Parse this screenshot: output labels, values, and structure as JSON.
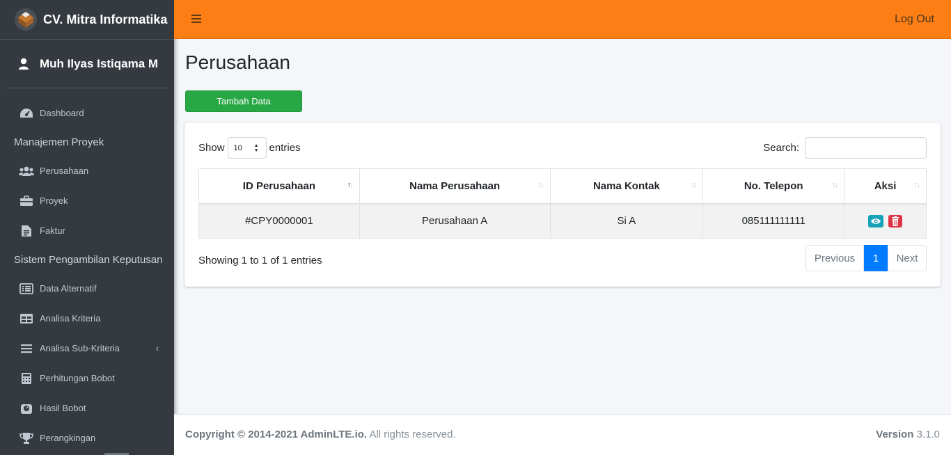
{
  "brand": {
    "name": "CV. Mitra Informatika",
    "logo_icon": "adminlte-logo-icon"
  },
  "user": {
    "name": "Muh Ilyas Istiqama M"
  },
  "sidebar": {
    "items": [
      {
        "label": "Dashboard",
        "icon": "tachometer-icon"
      },
      {
        "header": "Manajemen Proyek"
      },
      {
        "label": "Perusahaan",
        "icon": "users-icon"
      },
      {
        "label": "Proyek",
        "icon": "briefcase-icon"
      },
      {
        "label": "Faktur",
        "icon": "file-invoice-icon"
      },
      {
        "header": "Sistem Pengambilan Keputusan"
      },
      {
        "label": "Data Alternatif",
        "icon": "list-alt-icon"
      },
      {
        "label": "Analisa Kriteria",
        "icon": "table-icon"
      },
      {
        "label": "Analisa Sub-Kriteria",
        "icon": "bars-icon"
      },
      {
        "label": "Perhitungan Bobot",
        "icon": "calculator-icon"
      },
      {
        "label": "Hasil Bobot",
        "icon": "weight-icon"
      },
      {
        "label": "Perangkingan",
        "icon": "trophy-icon"
      }
    ]
  },
  "topbar": {
    "logout": "Log Out",
    "colors": {
      "accent": "#fd7e14"
    }
  },
  "page": {
    "title": "Perusahaan",
    "add_button": "Tambah Data"
  },
  "table_controls": {
    "show": "Show",
    "entries_value": "10",
    "entries": "entries",
    "search_label": "Search:"
  },
  "table": {
    "columns": [
      "ID Perusahaan",
      "Nama Perusahaan",
      "Nama Kontak",
      "No. Telepon",
      "Aksi"
    ],
    "rows": [
      {
        "id": "#CPY0000001",
        "nama": "Perusahaan A",
        "kontak": "Si A",
        "telepon": "085111111111"
      }
    ]
  },
  "pagination": {
    "info": "Showing 1 to 1 of 1 entries",
    "previous": "Previous",
    "current": "1",
    "next": "Next"
  },
  "footer": {
    "copyright": "Copyright © 2014-2021 AdminLTE.io.",
    "rights": " All rights reserved.",
    "version_label": "Version",
    "version": " 3.1.0"
  }
}
